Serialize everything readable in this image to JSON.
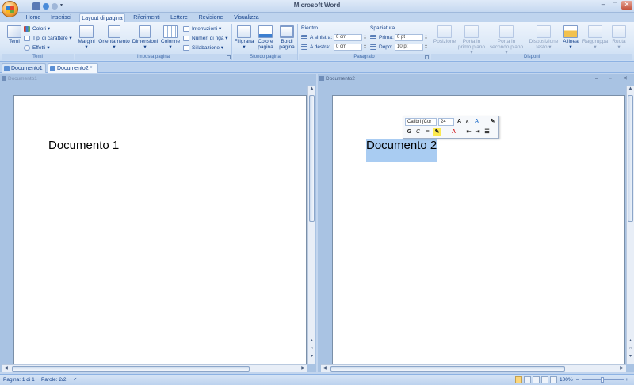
{
  "window": {
    "title": "Microsoft Word",
    "minimize": "–",
    "maximize": "□",
    "close": "✕"
  },
  "ribbon_tabs": [
    "Home",
    "Inserisci",
    "Layout di pagina",
    "Riferimenti",
    "Lettere",
    "Revisione",
    "Visualizza"
  ],
  "active_tab": "Layout di pagina",
  "groups": {
    "temi": {
      "label": "Temi",
      "temi_btn": "Temi",
      "colori": "Colori",
      "tipi_carattere": "Tipi di carattere",
      "effetti": "Effetti"
    },
    "imposta_pagina": {
      "label": "Imposta pagina",
      "margini": "Margini",
      "orientamento": "Orientamento",
      "dimensioni": "Dimensioni",
      "colonne": "Colonne",
      "interruzioni": "Interruzioni",
      "numeri_riga": "Numeri di riga",
      "sillabazione": "Sillabazione"
    },
    "sfondo_pagina": {
      "label": "Sfondo pagina",
      "filigrana": "Filigrana",
      "colore_pagina_1": "Colore",
      "colore_pagina_2": "pagina",
      "bordi_pagina_1": "Bordi",
      "bordi_pagina_2": "pagina"
    },
    "paragrafo": {
      "label": "Paragrafo",
      "rientro": "Rientro",
      "a_sinistra": "A sinistra:",
      "a_destra": "A destra:",
      "a_sinistra_val": "0 cm",
      "a_destra_val": "0 cm",
      "spaziatura": "Spaziatura",
      "prima": "Prima:",
      "dopo": "Dopo:",
      "prima_val": "0 pt",
      "dopo_val": "10 pt"
    },
    "disponi": {
      "label": "Disponi",
      "posizione": "Posizione",
      "porta_primo_1": "Porta in",
      "porta_primo_2": "primo piano",
      "porta_secondo_1": "Porta in",
      "porta_secondo_2": "secondo piano",
      "disposizione_1": "Disposizione",
      "disposizione_2": "testo",
      "allinea": "Allinea",
      "raggruppa": "Raggruppa",
      "ruota": "Ruota"
    }
  },
  "document_tabs": [
    {
      "name": "Documento1",
      "active": false
    },
    {
      "name": "Documento2 *",
      "active": true
    }
  ],
  "panes": {
    "left": {
      "title": "Documento1",
      "content": "Documento 1"
    },
    "right": {
      "title": "Documento2",
      "content": "Documento 2"
    }
  },
  "mini_toolbar": {
    "font": "Calibri (Cor",
    "size": "24",
    "grow": "A",
    "shrink": "A",
    "bold": "G",
    "italic": "C"
  },
  "status": {
    "pagina": "Pagina: 1 di 1",
    "parole": "Parole: 2/2",
    "zoom": "100%",
    "zoom_minus": "–",
    "zoom_plus": "+"
  },
  "colors": {
    "ribbon_text": "#15428b",
    "selection": "#a9ccf2",
    "window_frame": "#c2d5ee"
  }
}
